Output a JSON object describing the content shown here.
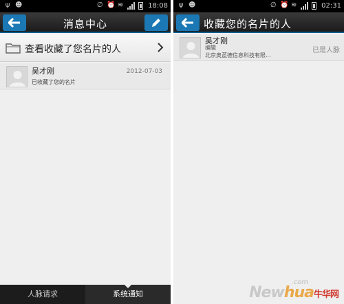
{
  "left_screen": {
    "status": {
      "time": "18:08"
    },
    "header": {
      "title": "消息中心",
      "back_icon": "back-arrow-icon",
      "edit_icon": "pencil-icon"
    },
    "favorites_row": {
      "label": "查看收藏了您名片的人",
      "icon": "folder-icon",
      "chevron": "chevron-right-icon"
    },
    "messages": [
      {
        "name": "吴才刚",
        "date": "2012-07-03",
        "text": "已收藏了您的名片"
      }
    ],
    "tabs": [
      {
        "label": "人脉请求",
        "active": false
      },
      {
        "label": "系统通知",
        "active": true
      }
    ]
  },
  "right_screen": {
    "status": {
      "time": "02:31"
    },
    "header": {
      "title": "收藏您的名片的人",
      "back_icon": "back-arrow-icon"
    },
    "contacts": [
      {
        "name": "吴才刚",
        "position": "编辑",
        "company": "北京奥蓝德信息科技有限...",
        "status": "已是人脉"
      }
    ]
  },
  "watermark": {
    "domain": ".com",
    "brand_new": "New",
    "brand_hua": "hua",
    "brand_cn": "牛华网"
  },
  "colors": {
    "accent_blue": "#1b78b5",
    "title_bar": "#1b1b1b",
    "background": "#efefef"
  }
}
